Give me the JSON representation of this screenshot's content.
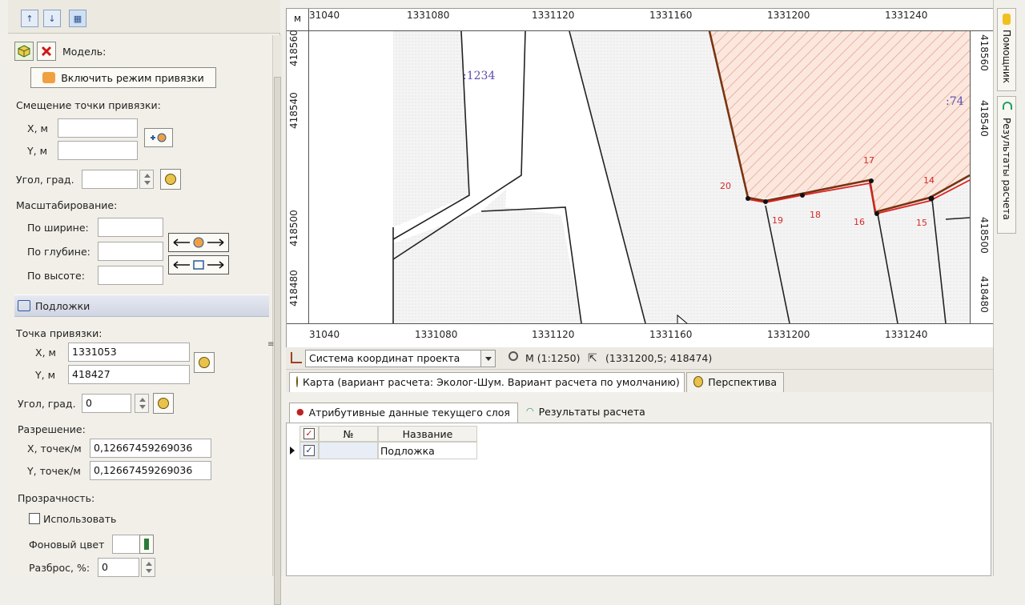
{
  "left_panel": {
    "model_label": "Модель:",
    "snap_button": "Включить режим привязки",
    "offset_title": "Смещение точки привязки:",
    "x_label": "X, м",
    "y_label": "Y, м",
    "angle_label": "Угол, град.",
    "scaling_title": "Масштабирование:",
    "by_width": "По ширине:",
    "by_depth": "По глубине:",
    "by_height": "По высоте:",
    "underlays_section": "Подложки",
    "anchor_title": "Точка привязки:",
    "anchor_x_label": "X, м",
    "anchor_x_value": "1331053",
    "anchor_y_label": "Y, м",
    "anchor_y_value": "418427",
    "anchor_angle_label": "Угол, град.",
    "anchor_angle_value": "0",
    "resolution_title": "Разрешение:",
    "res_x_label": "X, точек/м",
    "res_x_value": "0,12667459269036",
    "res_y_label": "Y, точек/м",
    "res_y_value": "0,12667459269036",
    "transparency_title": "Прозрачность:",
    "use_label": "Использовать",
    "bg_color_label": "Фоновый цвет",
    "spread_label": "Разброс, %:",
    "spread_value": "0"
  },
  "map": {
    "corner_label": "м",
    "top_ticks": [
      "31040",
      "1331080",
      "1331120",
      "1331160",
      "1331200",
      "1331240"
    ],
    "bottom_ticks": [
      "31040",
      "1331080",
      "1331120",
      "1331160",
      "1331200",
      "1331240"
    ],
    "left_ticks": [
      "418560",
      "418540",
      "418500",
      "418480"
    ],
    "right_ticks": [
      "418560",
      "418540",
      "418500",
      "418480"
    ],
    "parcel_labels": [
      ":1234",
      ":74"
    ],
    "point_labels": [
      "20",
      "19",
      "18",
      "17",
      "16",
      "15",
      "14"
    ],
    "colors": {
      "parcel_fill": "#f6dccf",
      "parcel_hatch": "#e0907a",
      "parcel_border": "#8a3b14",
      "red_line": "#e02020",
      "point_label": "#d62a2a",
      "parcel_text": "#5a4fb0"
    }
  },
  "map_toolbar": {
    "coord_system": "Система координат проекта",
    "scale": "M (1:1250)",
    "cursor_coords": "(1331200,5; 418474)"
  },
  "view_tabs": [
    {
      "label": "Карта (вариант расчета: Эколог-Шум. Вариант расчета по умолчанию)"
    },
    {
      "label": "Перспектива"
    }
  ],
  "data_tabs": [
    {
      "label": "Атрибутивные данные текущего слоя"
    },
    {
      "label": "Результаты расчета"
    }
  ],
  "grid": {
    "columns": [
      "№",
      "Название"
    ],
    "rows": [
      {
        "num": "",
        "name": "Подложка",
        "checked": true
      }
    ]
  },
  "side_tabs": [
    {
      "label": "Помощник"
    },
    {
      "label": "Результаты расчета"
    }
  ]
}
